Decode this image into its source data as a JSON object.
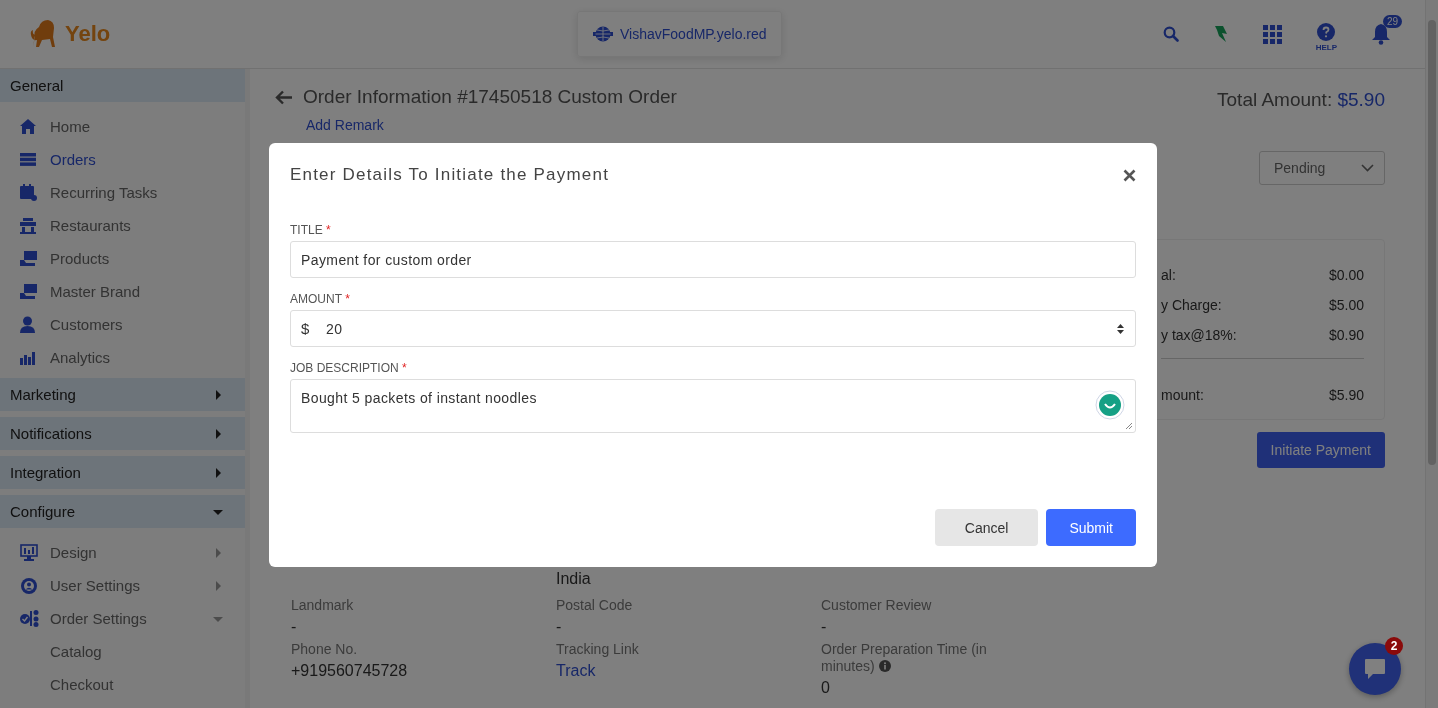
{
  "header": {
    "logo_text": "Yelo",
    "domain": "VishavFoodMP.yelo.red",
    "help_label": "HELP",
    "notification_count": "29"
  },
  "sidebar": {
    "groups": [
      {
        "label": "General",
        "kind": "plain",
        "items": [
          {
            "label": "Home",
            "selected": false
          },
          {
            "label": "Orders",
            "selected": true
          },
          {
            "label": "Recurring Tasks",
            "selected": false
          },
          {
            "label": "Restaurants",
            "selected": false
          },
          {
            "label": "Products",
            "selected": false
          },
          {
            "label": "Master Brand",
            "selected": false
          },
          {
            "label": "Customers",
            "selected": false
          },
          {
            "label": "Analytics",
            "selected": false
          }
        ]
      },
      {
        "label": "Marketing",
        "kind": "collapsible",
        "expanded": false
      },
      {
        "label": "Notifications",
        "kind": "collapsible",
        "expanded": false
      },
      {
        "label": "Integration",
        "kind": "collapsible",
        "expanded": false
      },
      {
        "label": "Configure",
        "kind": "collapsible",
        "expanded": true,
        "items": [
          {
            "label": "Design",
            "selected": false,
            "expanded": false
          },
          {
            "label": "User Settings",
            "selected": false,
            "expanded": false
          },
          {
            "label": "Order Settings",
            "selected": false,
            "expanded": true,
            "children": [
              {
                "label": "Catalog",
                "selected": false
              },
              {
                "label": "Checkout",
                "selected": false
              }
            ]
          }
        ]
      }
    ]
  },
  "main": {
    "title": "Order Information #17450518 Custom Order",
    "add_remark": "Add Remark",
    "total_label": "Total Amount:",
    "total_value": "$5.90",
    "status": "Pending",
    "summary": [
      {
        "label": "al:",
        "value": "$0.00",
        "kind": "line"
      },
      {
        "label": "y Charge:",
        "value": "$5.00",
        "kind": "line"
      },
      {
        "label": "y tax@18%:",
        "value": "$0.90",
        "kind": "line"
      },
      {
        "label": "mount:",
        "value": "$5.90",
        "kind": "total"
      }
    ],
    "initiate_button": "Initiate Payment",
    "address_tail": "India",
    "details": [
      {
        "label": "Landmark",
        "value": "-",
        "kind": "text"
      },
      {
        "label": "Postal Code",
        "value": "-",
        "kind": "text"
      },
      {
        "label": "Customer Review",
        "value": "-",
        "kind": "text"
      },
      {
        "label": "Phone No.",
        "value": "+919560745728",
        "kind": "text"
      },
      {
        "label": "Tracking Link",
        "value": "Track",
        "kind": "link"
      },
      {
        "label": "Order Preparation Time (in minutes)",
        "value": "0",
        "kind": "text",
        "info": true
      }
    ]
  },
  "modal": {
    "title": "Enter Details To Initiate the Payment",
    "required_mark": "*",
    "fields": [
      {
        "label": "TITLE",
        "required": true,
        "kind": "text",
        "value": "Payment for custom order"
      },
      {
        "label": "AMOUNT",
        "required": true,
        "kind": "number",
        "prefix": "$",
        "value": "20"
      },
      {
        "label": "JOB DESCRIPTION",
        "required": true,
        "kind": "textarea",
        "value": "Bought 5 packets of instant noodles"
      }
    ],
    "buttons": [
      {
        "label": "Cancel",
        "kind": "secondary"
      },
      {
        "label": "Submit",
        "kind": "primary"
      }
    ]
  },
  "chat": {
    "badge": "2"
  }
}
